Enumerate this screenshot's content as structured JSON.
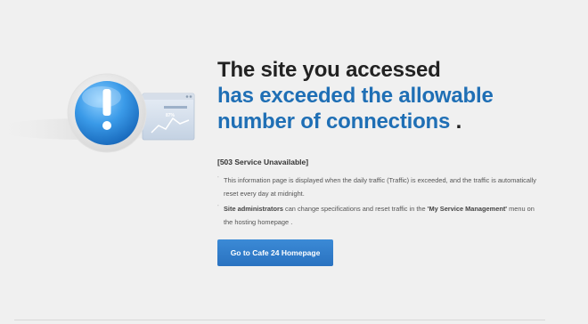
{
  "headline": {
    "line1": "The site you accessed",
    "line2": "has exceeded the allowable",
    "line3": "number of connections",
    "period": " ."
  },
  "status": "[503 Service Unavailable]",
  "info": {
    "item1": "This information page is displayed when the daily traffic (Traffic) is exceeded, and the traffic is automatically reset every day at midnight.",
    "item2_bold_start": "Site administrators",
    "item2_middle": " can change specifications and reset traffic in the ",
    "item2_bold_end": "'My Service Management'",
    "item2_end": " menu on the hosting homepage ."
  },
  "illustration": {
    "icon_glyph": "!",
    "panel_text": "87%"
  },
  "button_label": "Go to Cafe 24 Homepage",
  "colors": {
    "accent_blue": "#1f6fb5",
    "button_blue": "#2f7bc9",
    "background": "#f0f0f0"
  }
}
